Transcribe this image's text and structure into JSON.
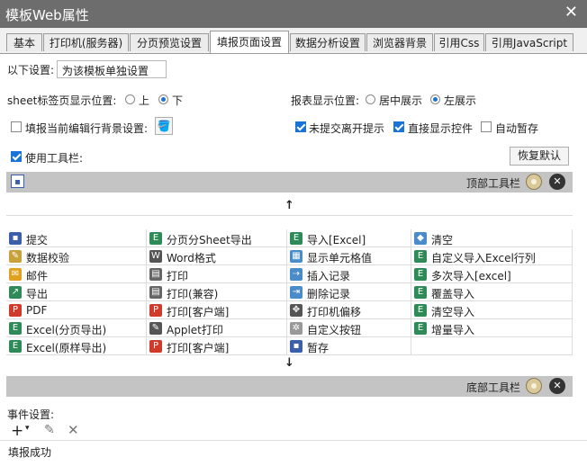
{
  "window": {
    "title": "模板Web属性"
  },
  "tabs": [
    "基本",
    "打印机(服务器)",
    "分页预览设置",
    "填报页面设置",
    "数据分析设置",
    "浏览器背景",
    "引用Css",
    "引用JavaScript"
  ],
  "settings": {
    "scope_label": "以下设置:",
    "scope_value": "为该模板单独设置",
    "sheet_pos_label": "sheet标签页显示位置:",
    "sheet_top": "上",
    "sheet_bottom": "下",
    "report_pos_label": "报表显示位置:",
    "report_center": "居中展示",
    "report_left": "左展示",
    "bg_label": "填报当前编辑行背景设置:",
    "unsubmitted_label": "未提交离开提示",
    "direct_control_label": "直接显示控件",
    "autosave_label": "自动暂存",
    "use_toolbar_label": "使用工具栏:",
    "restore_label": "恢复默认"
  },
  "toolbar": {
    "top_label": "顶部工具栏",
    "bottom_label": "底部工具栏"
  },
  "grid": {
    "rows": [
      [
        {
          "label": "提交",
          "icon": "save-icon",
          "color": "#3b5fa8"
        },
        {
          "label": "分页分Sheet导出",
          "icon": "excel-icon",
          "color": "#2e8b57"
        },
        {
          "label": "导入[Excel]",
          "icon": "excel-icon",
          "color": "#2e8b57"
        },
        {
          "label": "清空",
          "icon": "eraser-icon",
          "color": "#4a8cc9"
        }
      ],
      [
        {
          "label": "数据校验",
          "icon": "check-pen-icon",
          "color": "#c9a13a"
        },
        {
          "label": "Word格式",
          "icon": "word-icon",
          "color": "#555555"
        },
        {
          "label": "显示单元格值",
          "icon": "cell-icon",
          "color": "#4a8cc9"
        },
        {
          "label": "自定义导入Excel行列",
          "icon": "excel-icon",
          "color": "#2e8b57"
        }
      ],
      [
        {
          "label": "邮件",
          "icon": "mail-icon",
          "color": "#e0a020"
        },
        {
          "label": "打印",
          "icon": "print-icon",
          "color": "#666666"
        },
        {
          "label": "插入记录",
          "icon": "insert-icon",
          "color": "#4a8cc9"
        },
        {
          "label": "多次导入[excel]",
          "icon": "excel-icon",
          "color": "#2e8b57"
        }
      ],
      [
        {
          "label": "导出",
          "icon": "export-icon",
          "color": "#2e8b57"
        },
        {
          "label": "打印(兼容)",
          "icon": "print-icon",
          "color": "#666666"
        },
        {
          "label": "删除记录",
          "icon": "delete-row-icon",
          "color": "#4a8cc9"
        },
        {
          "label": "覆盖导入",
          "icon": "excel-icon",
          "color": "#2e8b57"
        }
      ],
      [
        {
          "label": "PDF",
          "icon": "pdf-icon",
          "color": "#d03a2a"
        },
        {
          "label": "打印[客户端]",
          "icon": "pdf-icon",
          "color": "#d03a2a"
        },
        {
          "label": "打印机偏移",
          "icon": "move-icon",
          "color": "#555555"
        },
        {
          "label": "清空导入",
          "icon": "excel-icon",
          "color": "#2e8b57"
        }
      ],
      [
        {
          "label": "Excel(分页导出)",
          "icon": "excel-icon",
          "color": "#2e8b57"
        },
        {
          "label": "Applet打印",
          "icon": "applet-icon",
          "color": "#555555"
        },
        {
          "label": "自定义按钮",
          "icon": "gear-icon",
          "color": "#999999"
        },
        {
          "label": "增量导入",
          "icon": "excel-icon",
          "color": "#2e8b57"
        }
      ],
      [
        {
          "label": "Excel(原样导出)",
          "icon": "excel-icon",
          "color": "#2e8b57"
        },
        {
          "label": "打印[客户端]",
          "icon": "pdf-icon",
          "color": "#d03a2a"
        },
        {
          "label": "暂存",
          "icon": "save-icon",
          "color": "#3b5fa8"
        },
        {
          "label": "",
          "icon": "",
          "color": ""
        }
      ]
    ]
  },
  "events": {
    "label": "事件设置:",
    "items": [
      "填报成功"
    ]
  }
}
